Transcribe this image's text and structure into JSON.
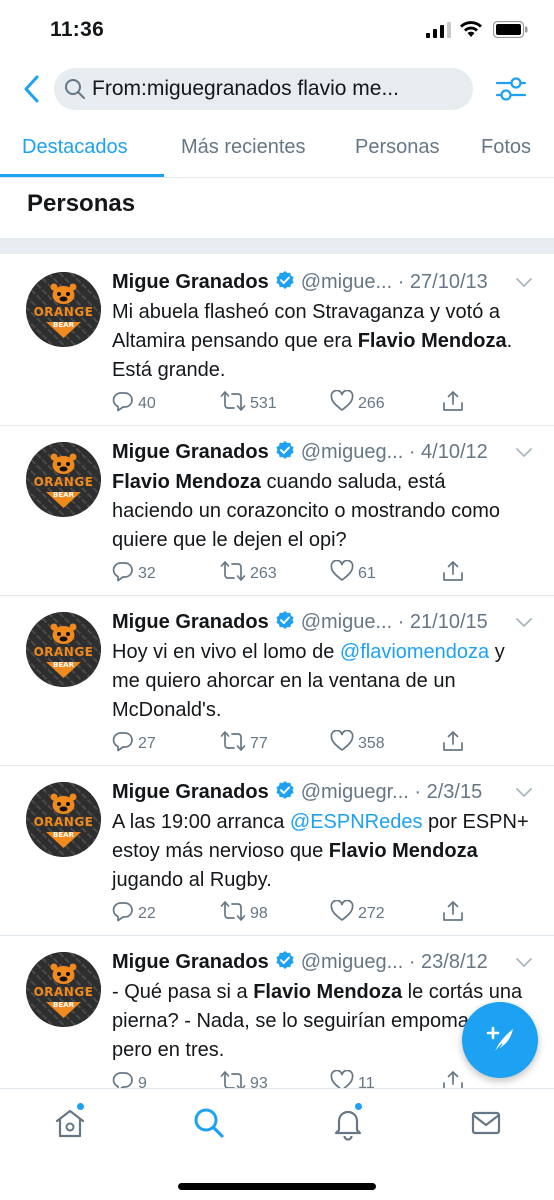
{
  "status_bar": {
    "time": "11:36"
  },
  "search": {
    "query": "From:miguegranados  flavio me..."
  },
  "tabs": [
    {
      "label": "Destacados",
      "active": true
    },
    {
      "label": "Más recientes",
      "active": false
    },
    {
      "label": "Personas",
      "active": false
    },
    {
      "label": "Fotos",
      "active": false
    }
  ],
  "section": {
    "title": "Personas"
  },
  "avatar_text": {
    "line1": "ORANGE",
    "line2": "BEAR"
  },
  "tweets": [
    {
      "name": "Migue Granados",
      "handle": "@migue...",
      "date": "· 27/10/13",
      "segments": [
        {
          "text": "Mi abuela flasheó con Stravaganza y votó a Altamira pensando que era ",
          "style": "normal"
        },
        {
          "text": "Flavio Mendoza",
          "style": "bold"
        },
        {
          "text": ". Está grande.",
          "style": "normal"
        }
      ],
      "replies": "40",
      "retweets": "531",
      "likes": "266"
    },
    {
      "name": "Migue Granados",
      "handle": "@migueg...",
      "date": "· 4/10/12",
      "segments": [
        {
          "text": "Flavio Mendoza",
          "style": "bold"
        },
        {
          "text": " cuando saluda, está haciendo un corazoncito o mostrando como quiere que le dejen el opi?",
          "style": "normal"
        }
      ],
      "replies": "32",
      "retweets": "263",
      "likes": "61"
    },
    {
      "name": "Migue Granados",
      "handle": "@migue...",
      "date": "· 21/10/15",
      "segments": [
        {
          "text": "Hoy vi en vivo el lomo de ",
          "style": "normal"
        },
        {
          "text": "@flaviomendoza",
          "style": "mention"
        },
        {
          "text": " y me quiero ahorcar en la ventana de un McDonald's.",
          "style": "normal"
        }
      ],
      "replies": "27",
      "retweets": "77",
      "likes": "358"
    },
    {
      "name": "Migue Granados",
      "handle": "@miguegr...",
      "date": "· 2/3/15",
      "segments": [
        {
          "text": "A las 19:00 arranca ",
          "style": "normal"
        },
        {
          "text": "@ESPNRedes",
          "style": "mention"
        },
        {
          "text": " por ESPN+ estoy más nervioso que ",
          "style": "normal"
        },
        {
          "text": "Flavio Mendoza",
          "style": "bold"
        },
        {
          "text": " jugando al Rugby.",
          "style": "normal"
        }
      ],
      "replies": "22",
      "retweets": "98",
      "likes": "272"
    },
    {
      "name": "Migue Granados",
      "handle": "@migueg...",
      "date": "· 23/8/12",
      "segments": [
        {
          "text": "- Qué pasa si a ",
          "style": "normal"
        },
        {
          "text": "Flavio Mendoza",
          "style": "bold"
        },
        {
          "text": " le cortás una pierna? - Nada, se lo seguirían empomando pero en tres.",
          "style": "normal"
        }
      ],
      "replies": "9",
      "retweets": "93",
      "likes": "11"
    }
  ],
  "icons": {
    "back": "chevron-left-icon",
    "search": "search-icon",
    "filter": "sliders-icon",
    "verified": "verified-badge-icon",
    "reply": "reply-icon",
    "retweet": "retweet-icon",
    "like": "heart-icon",
    "share": "share-icon",
    "compose": "compose-icon",
    "home": "home-icon",
    "explore": "search-icon",
    "notifications": "bell-icon",
    "messages": "mail-icon"
  },
  "colors": {
    "accent": "#1da1f2",
    "text": "#14171a",
    "secondary": "#657786",
    "separator": "#e6ecf0",
    "avatar_orange": "#f08a1c"
  }
}
